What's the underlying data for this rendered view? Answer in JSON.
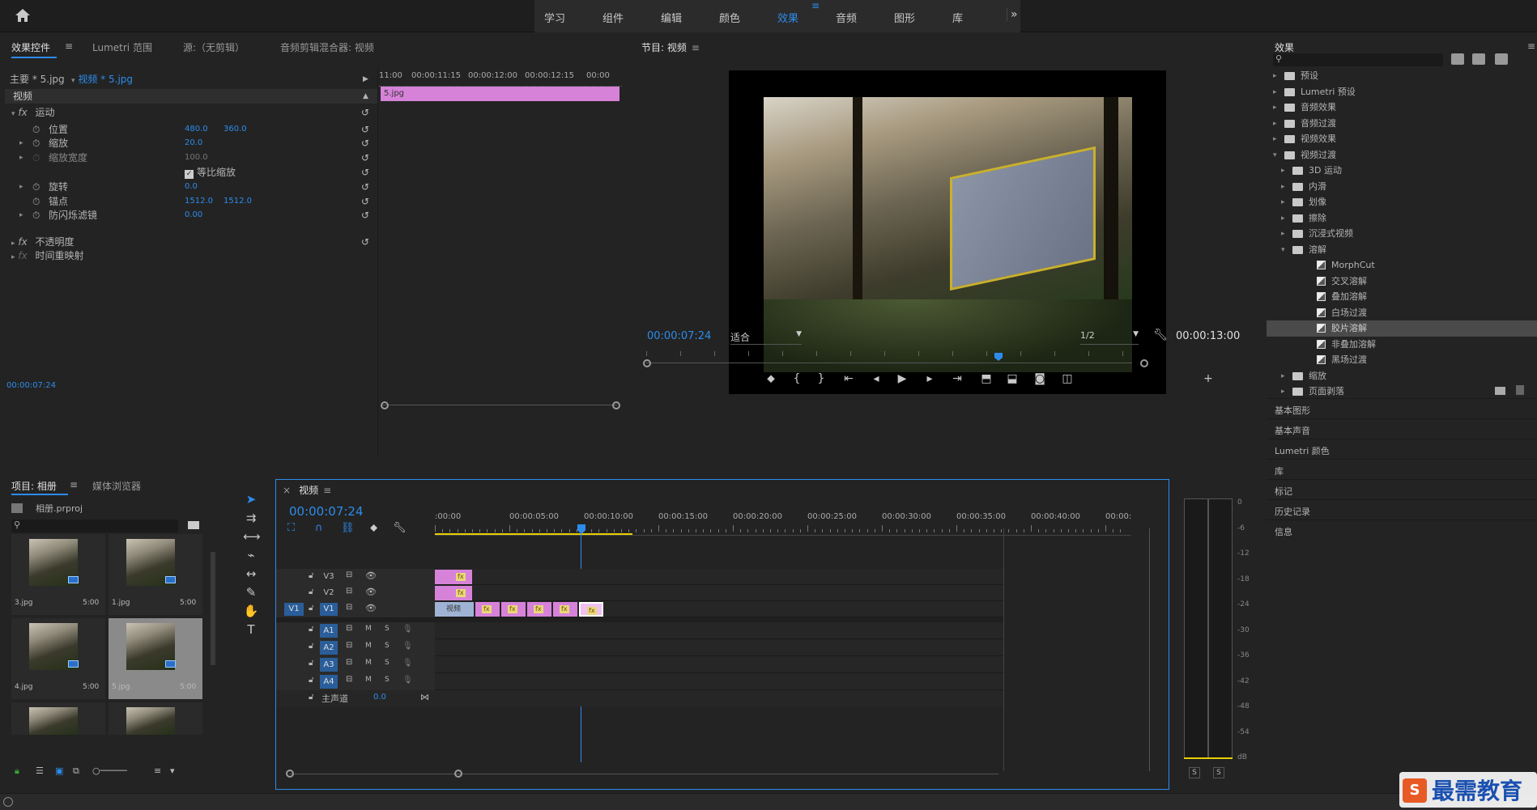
{
  "workspace_menu": {
    "items": [
      "学习",
      "组件",
      "编辑",
      "颜色",
      "效果",
      "音频",
      "图形",
      "库"
    ],
    "active": "效果",
    "more_label": "»"
  },
  "effect_controls": {
    "tabs": [
      "效果控件",
      "Lumetri 范围",
      "源:（无剪辑）",
      "音频剪辑混合器: 视频"
    ],
    "master_label": "主要 * 5.jpg",
    "clip_label": "视频 * 5.jpg",
    "section_video": "视频",
    "timecodes": [
      "11:00",
      "00:00:11:15",
      "00:00:12:00",
      "00:00:12:15",
      "00:00"
    ],
    "clip_bar_label": "5.jpg",
    "motion_label": "运动",
    "props": [
      {
        "name": "位置",
        "v1": "480.0",
        "v2": "360.0"
      },
      {
        "name": "缩放",
        "v1": "20.0",
        "v2": ""
      },
      {
        "name": "缩放宽度",
        "v1": "100.0",
        "v2": ""
      },
      {
        "name": "等比缩放",
        "v1": "",
        "v2": ""
      },
      {
        "name": "旋转",
        "v1": "0.0",
        "v2": ""
      },
      {
        "name": "锚点",
        "v1": "1512.0",
        "v2": "1512.0"
      },
      {
        "name": "防闪烁滤镜",
        "v1": "0.00",
        "v2": ""
      }
    ],
    "opacity_label": "不透明度",
    "remap_label": "时间重映射",
    "footer_time": "00:00:07:24"
  },
  "program_monitor": {
    "title": "节目: 视频",
    "current_time": "00:00:07:24",
    "fit_label": "适合",
    "resolution": "1/2",
    "duration": "00:00:13:00"
  },
  "effects_panel": {
    "title": "效果",
    "search_placeholder": "",
    "tree": [
      {
        "label": "预设",
        "level": 0,
        "open": false
      },
      {
        "label": "Lumetri 预设",
        "level": 0,
        "open": false
      },
      {
        "label": "音频效果",
        "level": 0,
        "open": false
      },
      {
        "label": "音频过渡",
        "level": 0,
        "open": false
      },
      {
        "label": "视频效果",
        "level": 0,
        "open": false
      },
      {
        "label": "视频过渡",
        "level": 0,
        "open": true
      },
      {
        "label": "3D 运动",
        "level": 1,
        "open": false
      },
      {
        "label": "内滑",
        "level": 1,
        "open": false
      },
      {
        "label": "划像",
        "level": 1,
        "open": false
      },
      {
        "label": "擦除",
        "level": 1,
        "open": false
      },
      {
        "label": "沉浸式视频",
        "level": 1,
        "open": false
      },
      {
        "label": "溶解",
        "level": 1,
        "open": true
      },
      {
        "label": "MorphCut",
        "level": 2,
        "leaf": true
      },
      {
        "label": "交叉溶解",
        "level": 2,
        "leaf": true
      },
      {
        "label": "叠加溶解",
        "level": 2,
        "leaf": true
      },
      {
        "label": "白场过渡",
        "level": 2,
        "leaf": true
      },
      {
        "label": "胶片溶解",
        "level": 2,
        "leaf": true,
        "selected": true
      },
      {
        "label": "非叠加溶解",
        "level": 2,
        "leaf": true
      },
      {
        "label": "黑场过渡",
        "level": 2,
        "leaf": true
      },
      {
        "label": "缩放",
        "level": 1,
        "open": false
      },
      {
        "label": "页面剥落",
        "level": 1,
        "open": false
      }
    ],
    "sections": [
      "基本图形",
      "基本声音",
      "Lumetri 颜色",
      "库",
      "标记",
      "历史记录",
      "信息"
    ]
  },
  "project_panel": {
    "tabs": [
      "项目: 相册",
      "媒体浏览器"
    ],
    "project_file": "相册.prproj",
    "items": [
      {
        "name": "3.jpg",
        "duration": "5:00"
      },
      {
        "name": "1.jpg",
        "duration": "5:00"
      },
      {
        "name": "4.jpg",
        "duration": "5:00"
      },
      {
        "name": "5.jpg",
        "duration": "5:00"
      }
    ]
  },
  "timeline": {
    "title": "视频",
    "current_time": "00:00:07:24",
    "ruler": [
      ":00:00",
      "00:00:05:00",
      "00:00:10:00",
      "00:00:15:00",
      "00:00:20:00",
      "00:00:25:00",
      "00:00:30:00",
      "00:00:35:00",
      "00:00:40:00",
      "00:00:"
    ],
    "video_tracks": [
      "V3",
      "V2",
      "V1"
    ],
    "source_patch": "V1",
    "audio_tracks": [
      "A1",
      "A2",
      "A3",
      "A4"
    ],
    "mute_label": "M",
    "solo_label": "S",
    "master_label": "主声道",
    "master_value": "0.0",
    "clip_label": "视频",
    "fx_label": "fx"
  },
  "audio_meter": {
    "scale": [
      "0",
      "-6",
      "-12",
      "-18",
      "-24",
      "-30",
      "-36",
      "-42",
      "-48",
      "-54",
      "dB"
    ],
    "solo_labels": [
      "S",
      "S"
    ]
  },
  "watermark": {
    "text": "最需教育"
  }
}
